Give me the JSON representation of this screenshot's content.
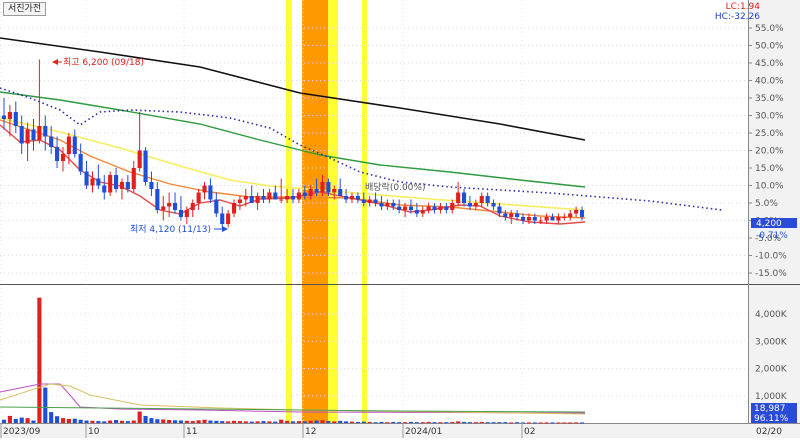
{
  "panel_tag": "서진가전",
  "lc_label": "LC:1.94",
  "hc_label": "HC:-32.26",
  "current_price_badge": "4,200",
  "current_pct_badge": "-0.71%",
  "volume_badge": "18,987",
  "volume_pct_badge": "96.11%",
  "date_badge": "02/20",
  "colors": {
    "up": "#e0201e",
    "down": "#1f4fd8",
    "ma_long": "#111111",
    "ma_green": "#2e9a3e",
    "ma_yellow": "#f6ee5a",
    "ma_orange": "#f0883a",
    "ma_red": "#e44c4c",
    "dotted": "#2a2aa8",
    "highlight_yellow": "#ffff33",
    "highlight_orange": "#ff9900"
  },
  "chart_data": {
    "type": "candlestick",
    "y_axis_labels": [
      "55.0%",
      "50.0%",
      "45.0%",
      "40.0%",
      "35.0%",
      "30.0%",
      "25.0%",
      "20.0%",
      "15.0%",
      "10.0%",
      "5.0%",
      "0.0%",
      "-5.0%",
      "-10.0%",
      "-15.0%"
    ],
    "volume_axis_labels": [
      "4,000K",
      "3,000K",
      "2,000K",
      "1,000K"
    ],
    "x_axis_labels": [
      "2023/09",
      "10",
      "11",
      "12",
      "2024/01",
      "02"
    ],
    "annotations": {
      "high": "최고 6,200 (09/18)",
      "low": "최저 4,120 (11/13)",
      "dividend": "배당락(0.00%)"
    },
    "candles_percent": [
      [
        30,
        35,
        26,
        29
      ],
      [
        29,
        33,
        24,
        31
      ],
      [
        31,
        34,
        25,
        27
      ],
      [
        27,
        30,
        19,
        22
      ],
      [
        22,
        28,
        17,
        26
      ],
      [
        26,
        29,
        20,
        23
      ],
      [
        23,
        46,
        22,
        27
      ],
      [
        27,
        30,
        20,
        24
      ],
      [
        24,
        27,
        19,
        21
      ],
      [
        21,
        24,
        15,
        17
      ],
      [
        17,
        21,
        14,
        19
      ],
      [
        19,
        25,
        16,
        24
      ],
      [
        24,
        26,
        18,
        19
      ],
      [
        19,
        22,
        13,
        14
      ],
      [
        14,
        17,
        9,
        10
      ],
      [
        10,
        14,
        8,
        12
      ],
      [
        12,
        16,
        9,
        10
      ],
      [
        10,
        13,
        6,
        8
      ],
      [
        8,
        14,
        7,
        13
      ],
      [
        13,
        15,
        8,
        9
      ],
      [
        9,
        12,
        6,
        11
      ],
      [
        11,
        13,
        8,
        9
      ],
      [
        9,
        17,
        8,
        15
      ],
      [
        15,
        31,
        14,
        20
      ],
      [
        20,
        21,
        10,
        11
      ],
      [
        11,
        14,
        7,
        9
      ],
      [
        9,
        11,
        2,
        3
      ],
      [
        3,
        7,
        0,
        4
      ],
      [
        4,
        8,
        1,
        5
      ],
      [
        5,
        8,
        2,
        3
      ],
      [
        3,
        7,
        0,
        1
      ],
      [
        1,
        4,
        -1,
        3
      ],
      [
        3,
        6,
        1,
        5
      ],
      [
        5,
        9,
        3,
        8
      ],
      [
        8,
        11,
        6,
        10
      ],
      [
        10,
        12,
        5,
        6
      ],
      [
        6,
        8,
        1,
        2
      ],
      [
        2,
        4,
        -2,
        -1
      ],
      [
        -1,
        3,
        -2,
        2
      ],
      [
        2,
        6,
        1,
        5
      ],
      [
        5,
        7,
        3,
        6
      ],
      [
        6,
        9,
        4,
        7
      ],
      [
        7,
        10,
        5,
        5
      ],
      [
        5,
        8,
        3,
        7
      ],
      [
        7,
        9,
        5,
        6
      ],
      [
        6,
        9,
        5,
        8
      ],
      [
        8,
        10,
        6,
        6
      ],
      [
        6,
        12,
        5,
        6
      ],
      [
        6,
        9,
        5,
        7
      ],
      [
        7,
        9,
        5,
        6
      ],
      [
        6,
        9,
        5,
        8
      ],
      [
        8,
        10,
        6,
        7
      ],
      [
        7,
        10,
        6,
        9
      ],
      [
        9,
        12,
        7,
        8
      ],
      [
        8,
        13,
        7,
        11
      ],
      [
        11,
        12,
        7,
        8
      ],
      [
        8,
        10,
        6,
        9
      ],
      [
        9,
        12,
        7,
        7
      ],
      [
        7,
        9,
        5,
        6
      ],
      [
        6,
        8,
        5,
        7
      ],
      [
        7,
        8,
        5,
        6
      ],
      [
        6,
        8,
        4,
        5
      ],
      [
        5,
        7,
        4,
        6
      ],
      [
        6,
        8,
        4,
        5
      ],
      [
        5,
        7,
        3,
        4
      ],
      [
        4,
        6,
        3,
        5
      ],
      [
        5,
        6,
        3,
        4
      ],
      [
        4,
        6,
        2,
        3
      ],
      [
        3,
        5,
        1,
        4
      ],
      [
        4,
        6,
        2,
        3
      ],
      [
        3,
        5,
        1,
        2
      ],
      [
        2,
        4,
        1,
        3
      ],
      [
        3,
        5,
        2,
        4
      ],
      [
        4,
        5,
        2,
        3
      ],
      [
        3,
        5,
        2,
        4
      ],
      [
        4,
        5,
        2,
        3
      ],
      [
        3,
        6,
        2,
        5
      ],
      [
        5,
        11,
        4,
        8
      ],
      [
        8,
        9,
        4,
        5
      ],
      [
        5,
        7,
        3,
        4
      ],
      [
        4,
        6,
        3,
        5
      ],
      [
        5,
        8,
        4,
        7
      ],
      [
        7,
        8,
        4,
        5
      ],
      [
        5,
        6,
        3,
        4
      ],
      [
        4,
        5,
        1,
        2
      ],
      [
        2,
        3,
        0,
        1
      ],
      [
        1,
        3,
        -1,
        2
      ],
      [
        2,
        3,
        0,
        1
      ],
      [
        1,
        2,
        -1,
        0
      ],
      [
        0,
        2,
        -1,
        1
      ],
      [
        1,
        2,
        -1,
        0
      ],
      [
        0,
        1,
        -1,
        0
      ],
      [
        0,
        2,
        -1,
        1
      ],
      [
        1,
        2,
        0,
        0
      ],
      [
        0,
        2,
        -1,
        1
      ],
      [
        1,
        2,
        0,
        1
      ],
      [
        1,
        3,
        0,
        2
      ],
      [
        2,
        4,
        1,
        3
      ],
      [
        3,
        4,
        0,
        1
      ]
    ],
    "volume_thousands": [
      120,
      260,
      150,
      200,
      180,
      90,
      4600,
      1300,
      400,
      250,
      180,
      150,
      160,
      120,
      90,
      80,
      70,
      60,
      90,
      110,
      80,
      70,
      90,
      420,
      260,
      180,
      140,
      130,
      110,
      100,
      90,
      80,
      70,
      100,
      120,
      90,
      80,
      70,
      60,
      80,
      70,
      60,
      50,
      60,
      70,
      60,
      50,
      120,
      80,
      60,
      70,
      60,
      80,
      90,
      100,
      70,
      60,
      80,
      60,
      50,
      40,
      50,
      40,
      30,
      40,
      30,
      40,
      30,
      30,
      40,
      30,
      30,
      40,
      30,
      30,
      30,
      40,
      60,
      40,
      30,
      30,
      40,
      30,
      30,
      30,
      30,
      20,
      30,
      20,
      20,
      20,
      20,
      20,
      20,
      20,
      20,
      20,
      20,
      20
    ]
  }
}
